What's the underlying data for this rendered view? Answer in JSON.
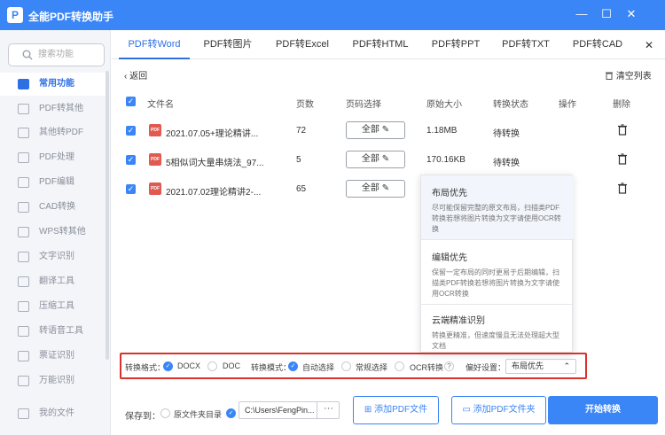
{
  "app": {
    "title": "全能PDF转换助手",
    "logo": "P"
  },
  "window": {
    "min": "—",
    "max": "☐",
    "close": "✕"
  },
  "sidebar": {
    "search_placeholder": "搜索功能",
    "items": [
      {
        "label": "常用功能",
        "active": true
      },
      {
        "label": "PDF转其他"
      },
      {
        "label": "其他转PDF"
      },
      {
        "label": "PDF处理"
      },
      {
        "label": "PDF编辑"
      },
      {
        "label": "CAD转换"
      },
      {
        "label": "WPS转其他"
      },
      {
        "label": "文字识别"
      },
      {
        "label": "翻译工具"
      },
      {
        "label": "压缩工具"
      },
      {
        "label": "转语音工具"
      },
      {
        "label": "票证识别"
      },
      {
        "label": "万能识别"
      },
      {
        "label": "我的文件"
      }
    ]
  },
  "tabs": [
    "PDF转Word",
    "PDF转图片",
    "PDF转Excel",
    "PDF转HTML",
    "PDF转PPT",
    "PDF转TXT",
    "PDF转CAD"
  ],
  "tabs_close": "✕",
  "back_label": "返回",
  "clear_label": "清空列表",
  "table": {
    "headers": {
      "name": "文件名",
      "pages": "页数",
      "page_select": "页码选择",
      "size": "原始大小",
      "status": "转换状态",
      "action": "操作",
      "delete": "删除"
    },
    "rows": [
      {
        "name": "2021.07.05+理论精讲...",
        "pages": "72",
        "page_select": "全部",
        "size": "1.18MB",
        "status": "待转换"
      },
      {
        "name": "5相似词大量串烧法_97...",
        "pages": "5",
        "page_select": "全部",
        "size": "170.16KB",
        "status": "待转换"
      },
      {
        "name": "2021.07.02理论精讲2-...",
        "pages": "65",
        "page_select": "全部",
        "size": "",
        "status": ""
      }
    ]
  },
  "popup": {
    "options": [
      {
        "title": "布局优先",
        "desc": "尽可能保留完整的原文布局，扫描类PDF转换若想将图片转换为文字请使用OCR转换"
      },
      {
        "title": "编辑优先",
        "desc": "保留一定布局的同时更易于后期编辑，扫描类PDF转换若想将图片转换为文字请使用OCR转换"
      },
      {
        "title": "云端精准识别",
        "desc": "转换更精准，但速度慢且无法处理超大型文档"
      }
    ]
  },
  "settings": {
    "format_label": "转换格式：",
    "format_options": [
      "DOCX",
      "DOC"
    ],
    "mode_label": "转换模式：",
    "mode_options": [
      "自动选择",
      "常规选择",
      "OCR转换"
    ],
    "help": "?",
    "pref_label": "偏好设置：",
    "pref_value": "布局优先"
  },
  "bottom": {
    "save_label": "保存到：",
    "option_source": "原文件夹目录",
    "path_value": "C:\\Users\\FengPin...",
    "browse": "···",
    "add_file": "添加PDF文件",
    "add_folder": "添加PDF文件夹",
    "start": "开始转换"
  },
  "colors": {
    "accent": "#3b86f6",
    "highlight": "#d9312b"
  }
}
